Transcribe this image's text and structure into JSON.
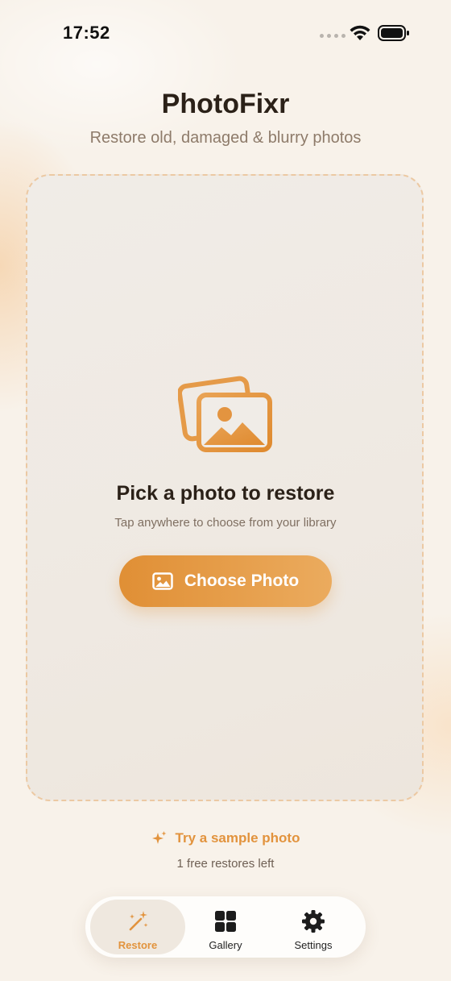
{
  "status_bar": {
    "time": "17:52",
    "icons": [
      "signal-dots-icon",
      "wifi-icon",
      "battery-icon"
    ]
  },
  "header": {
    "title": "PhotoFixr",
    "subtitle": "Restore old, damaged & blurry photos"
  },
  "picker": {
    "icon": "photos-icon",
    "title": "Pick a photo to restore",
    "subtitle": "Tap anywhere to choose from your library",
    "button_label": "Choose Photo",
    "button_icon": "photo-icon"
  },
  "sample": {
    "label": "Try a sample photo",
    "icon": "sparkles-icon"
  },
  "restores_left": "1 free restores left",
  "tabs": [
    {
      "label": "Restore",
      "icon": "magic-wand-icon",
      "active": true
    },
    {
      "label": "Gallery",
      "icon": "grid-icon",
      "active": false
    },
    {
      "label": "Settings",
      "icon": "gear-icon",
      "active": false
    }
  ],
  "colors": {
    "accent": "#E2933D",
    "background": "#F8F2EA",
    "title_text": "#2B2118"
  }
}
